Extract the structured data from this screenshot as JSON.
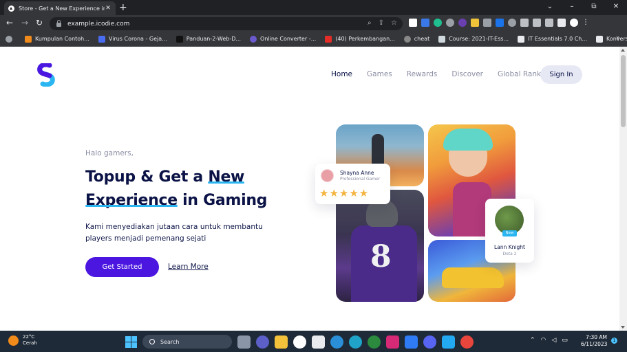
{
  "browser": {
    "tab_title": "Store - Get a New Experience in Gaming",
    "new_tab": "+",
    "url": "example.icodie.com",
    "win_min": "–",
    "win_max": "⧉",
    "win_close": "✕",
    "bookmarks": [
      {
        "label": "Kumpulan Contoh...",
        "color": "#f08a1a"
      },
      {
        "label": "Virus Corona - Geja...",
        "color": "#4a6cf0"
      },
      {
        "label": "Panduan-2-Web-D...",
        "color": "#222222"
      },
      {
        "label": "Online Converter -...",
        "color": "#6a5acd"
      },
      {
        "label": "(40) Perkembangan...",
        "color": "#e52d27"
      },
      {
        "label": "cheat",
        "color": "#888888"
      },
      {
        "label": "Course: 2021-IT-Ess...",
        "color": "#cfd8dc"
      },
      {
        "label": "IT Essentials 7.0 Ch...",
        "color": "#1a1a1a"
      },
      {
        "label": "Konversi Online IP k...",
        "color": "#1a1a1a"
      }
    ],
    "bookmarks_more": "»"
  },
  "site": {
    "nav": [
      "Home",
      "Games",
      "Rewards",
      "Discover",
      "Global Rank"
    ],
    "signin": "Sign In",
    "greeting": "Halo gamers,",
    "headline_1": "Topup & Get a ",
    "headline_2": "New",
    "headline_3": "Experience",
    "headline_4": " in Gaming",
    "description": "Kami menyediakan jutaan cara untuk membantu players menjadi pemenang sejati",
    "cta_primary": "Get Started",
    "cta_secondary": "Learn More",
    "card1_name": "Shayna Anne",
    "card1_role": "Professional Gamer",
    "card1_stars": "★★★★★",
    "card2_badge": "New",
    "card2_name": "Lann Knight",
    "card2_game": "Dota 2",
    "jersey_number": "8",
    "accent": "#4a16e0",
    "underline": "#2bb6f2"
  },
  "taskbar": {
    "temp": "22°C",
    "weather": "Cerah",
    "search": "Search",
    "time": "7:30 AM",
    "date": "6/11/2023",
    "notifications": "1"
  }
}
